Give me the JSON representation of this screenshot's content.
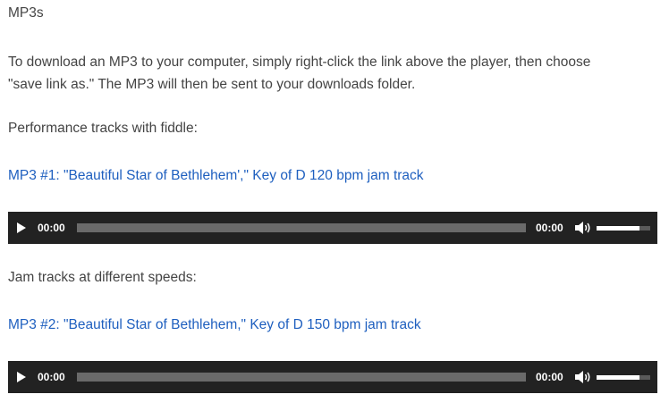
{
  "heading": "MP3s",
  "instructions": {
    "line1": "To download an MP3 to your computer, simply right-click the link above the player, then choose",
    "line2": "\"save link as.\" The MP3 will then be sent to your downloads folder."
  },
  "sections": [
    {
      "title": "Performance tracks with fiddle:",
      "track_link": "MP3 #1: \"Beautiful Star of Bethlehem',\" Key of D 120 bpm jam track",
      "player": {
        "current_time": "00:00",
        "duration": "00:00",
        "progress": 0,
        "volume": 0.8
      }
    },
    {
      "title": "Jam tracks at different speeds:",
      "track_link": "MP3 #2: \"Beautiful Star of Bethlehem,\" Key of D 150 bpm jam track",
      "player": {
        "current_time": "00:00",
        "duration": "00:00",
        "progress": 0,
        "volume": 0.8
      }
    }
  ],
  "colors": {
    "text": "#444444",
    "link": "#1e5fbf",
    "player_bg": "#222222",
    "player_track": "#6a6a6a"
  },
  "icons": {
    "play": "play-icon",
    "volume": "speaker-icon"
  }
}
